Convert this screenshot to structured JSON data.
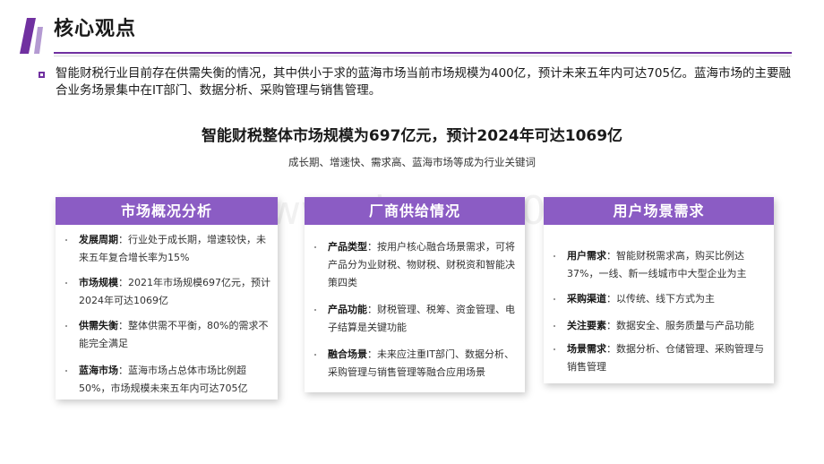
{
  "header": {
    "title": "核心观点"
  },
  "intro": "智能财税行业目前存在供需失衡的情况，其中供小于求的蓝海市场当前市场规模为400亿，预计未来五年内可达705亿。蓝海市场的主要融合业务场景集中在IT部门、数据分析、采购管理与销售管理。",
  "headline": "智能财税整体市场规模为697亿元，预计2024年可达1069亿",
  "subline": "成长期、增速快、需求高、蓝海市场等成为行业关键词",
  "watermark": "www.baogao0.com",
  "colors": {
    "accent": "#7030a0",
    "card_header": "#8b5cc4"
  },
  "cards": [
    {
      "title": "市场概况分析",
      "items": [
        {
          "label": "发展周期",
          "text": "：行业处于成长期，增速较快，未来五年复合增长率为15%"
        },
        {
          "label": "市场规模",
          "text": "：2021年市场规模697亿元，预计2024年可达1069亿"
        },
        {
          "label": "供需失衡",
          "text": "：整体供需不平衡，80%的需求不能完全满足"
        },
        {
          "label": "蓝海市场",
          "text": "：蓝海市场占总体市场比例超50%，市场规模未来五年内可达705亿"
        }
      ]
    },
    {
      "title": "厂商供给情况",
      "items": [
        {
          "label": "产品类型",
          "text": "：按用户核心融合场景需求，可将产品分为业财税、物财税、财税资和智能决策四类"
        },
        {
          "label": "产品功能",
          "text": "：财税管理、税筹、资金管理、电子结算是关键功能"
        },
        {
          "label": "融合场景",
          "text": "：未来应注重IT部门、数据分析、采购管理与销售管理等融合应用场景"
        }
      ]
    },
    {
      "title": "用户场景需求",
      "items": [
        {
          "label": "用户需求",
          "text": "：智能财税需求高，购买比例达37%，一线、新一线城市中大型企业为主"
        },
        {
          "label": "采购渠道",
          "text": "：以传统、线下方式为主"
        },
        {
          "label": "关注要素",
          "text": "：数据安全、服务质量与产品功能"
        },
        {
          "label": "场景需求",
          "text": "：数据分析、仓储管理、采购管理与销售管理"
        }
      ]
    }
  ]
}
